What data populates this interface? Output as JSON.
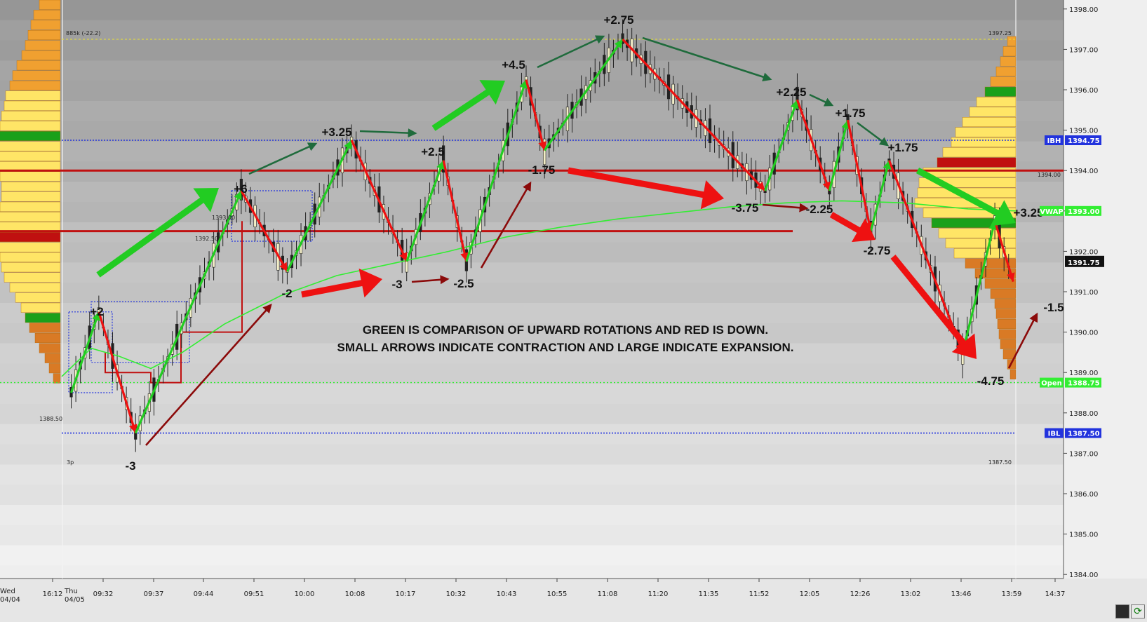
{
  "chart_data": {
    "type": "candlestick",
    "instrument_note": "885k (-22.2)",
    "y_range": [
      1383.9,
      1398.1
    ],
    "y_ticks": [
      "1398.00",
      "1397.00",
      "1396.00",
      "1395.00",
      "1394.00",
      "1393.00",
      "1392.00",
      "1391.00",
      "1390.00",
      "1389.00",
      "1388.00",
      "1387.00",
      "1386.00",
      "1385.00",
      "1384.00"
    ],
    "x_ticks": [
      "16:12",
      "09:32",
      "09:37",
      "09:44",
      "09:51",
      "10:00",
      "10:08",
      "10:17",
      "10:32",
      "10:43",
      "10:55",
      "11:08",
      "11:20",
      "11:35",
      "11:52",
      "12:05",
      "12:26",
      "13:02",
      "13:46",
      "13:59",
      "14:37"
    ],
    "session_labels": [
      {
        "top": "Wed",
        "bottom": "04/04"
      },
      {
        "top": "Thu",
        "bottom": "04/05"
      }
    ],
    "levels": [
      {
        "name": "IBH",
        "value": "1394.75"
      },
      {
        "name": "VWAP",
        "value": "1393.00"
      },
      {
        "name": "Open",
        "value": "1388.75"
      },
      {
        "name": "IBL",
        "value": "1387.50"
      }
    ],
    "last_price": "1391.75",
    "red_line_labels": [
      "1394.00"
    ],
    "small_labels": [
      "1397.25",
      "1393.00",
      "1392.50",
      "1388.50",
      "1387.50",
      "3p"
    ],
    "rotation_points": [
      {
        "x": 1,
        "price": 1388.5
      },
      {
        "x": 7,
        "price": 1390.5,
        "label": "+2"
      },
      {
        "x": 15,
        "price": 1387.5,
        "label": "-3"
      },
      {
        "x": 38,
        "price": 1393.5,
        "label": "+6"
      },
      {
        "x": 48,
        "price": 1391.5,
        "label": "-2"
      },
      {
        "x": 62,
        "price": 1394.75,
        "label": "+3.25"
      },
      {
        "x": 74,
        "price": 1391.75,
        "label": "-3"
      },
      {
        "x": 82,
        "price": 1394.25,
        "label": "+2.5"
      },
      {
        "x": 87,
        "price": 1391.75,
        "label": "-2.5"
      },
      {
        "x": 100,
        "price": 1396.25,
        "label": "+4.5"
      },
      {
        "x": 104,
        "price": 1394.5,
        "label": "-1.75"
      },
      {
        "x": 121,
        "price": 1397.25,
        "label": "+2.75"
      },
      {
        "x": 152,
        "price": 1393.5,
        "label": "-3.75"
      },
      {
        "x": 159,
        "price": 1395.75,
        "label": "+2.25"
      },
      {
        "x": 166,
        "price": 1393.5,
        "label": "-2.25"
      },
      {
        "x": 170,
        "price": 1395.25,
        "label": "+1.75"
      },
      {
        "x": 175,
        "price": 1392.5,
        "label": "-2.75"
      },
      {
        "x": 179,
        "price": 1394.25,
        "label": "+1.75"
      },
      {
        "x": 195,
        "price": 1389.5,
        "label": "-4.75"
      },
      {
        "x": 202,
        "price": 1392.75,
        "label": "+3.25"
      },
      {
        "x": 206,
        "price": 1391.25,
        "label": "-1.5"
      }
    ],
    "note_lines": [
      "GREEN IS COMPARISON OF UPWARD ROTATIONS AND RED IS DOWN.",
      "SMALL ARROWS INDICATE CONTRACTION AND LARGE INDICATE EXPANSION."
    ]
  },
  "colors": {
    "up": "#22cc22",
    "down": "#ee1111",
    "dark_up": "#1f6b3c",
    "dark_down": "#8b0a0a",
    "red_level": "#c01010",
    "vwap": "#33ee33",
    "dotted_blue": "#2233dd",
    "profile_yellow": "#ffe566",
    "profile_orange": "#f0a030",
    "profile_deep": "#d97a25",
    "profile_green": "#1aa01a"
  }
}
